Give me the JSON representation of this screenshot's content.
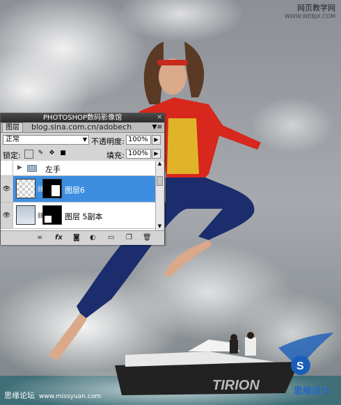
{
  "watermarks": {
    "top_right_name": "网页教学网",
    "top_right_url": "WWW.WEBJX.COM",
    "bottom_left_name": "思缘论坛",
    "bottom_left_url": "www.missyuan.com",
    "boat_text": "TIRION",
    "logo_text": "思缘设计"
  },
  "panel": {
    "title": "PHOTOSHOP数码影像馆",
    "tab_label": "图层",
    "blog_text": "blog.sina.com.cn/adobech",
    "blend_mode": "正常",
    "opacity_label": "不透明度:",
    "opacity_value": "100%",
    "lock_label": "锁定:",
    "fill_label": "填充:",
    "fill_value": "100%",
    "layers": [
      {
        "name": "左手",
        "type": "group",
        "selected": false,
        "visible": false
      },
      {
        "name": "图层6",
        "type": "layer",
        "selected": true,
        "visible": true
      },
      {
        "name": "图层 5副本",
        "type": "layer",
        "selected": false,
        "visible": true
      }
    ],
    "bottom_icons": [
      "link-icon",
      "fx-icon",
      "mask-icon",
      "adjustment-icon",
      "group-icon",
      "new-layer-icon",
      "trash-icon"
    ],
    "selection_color": "#3d8ee0"
  }
}
